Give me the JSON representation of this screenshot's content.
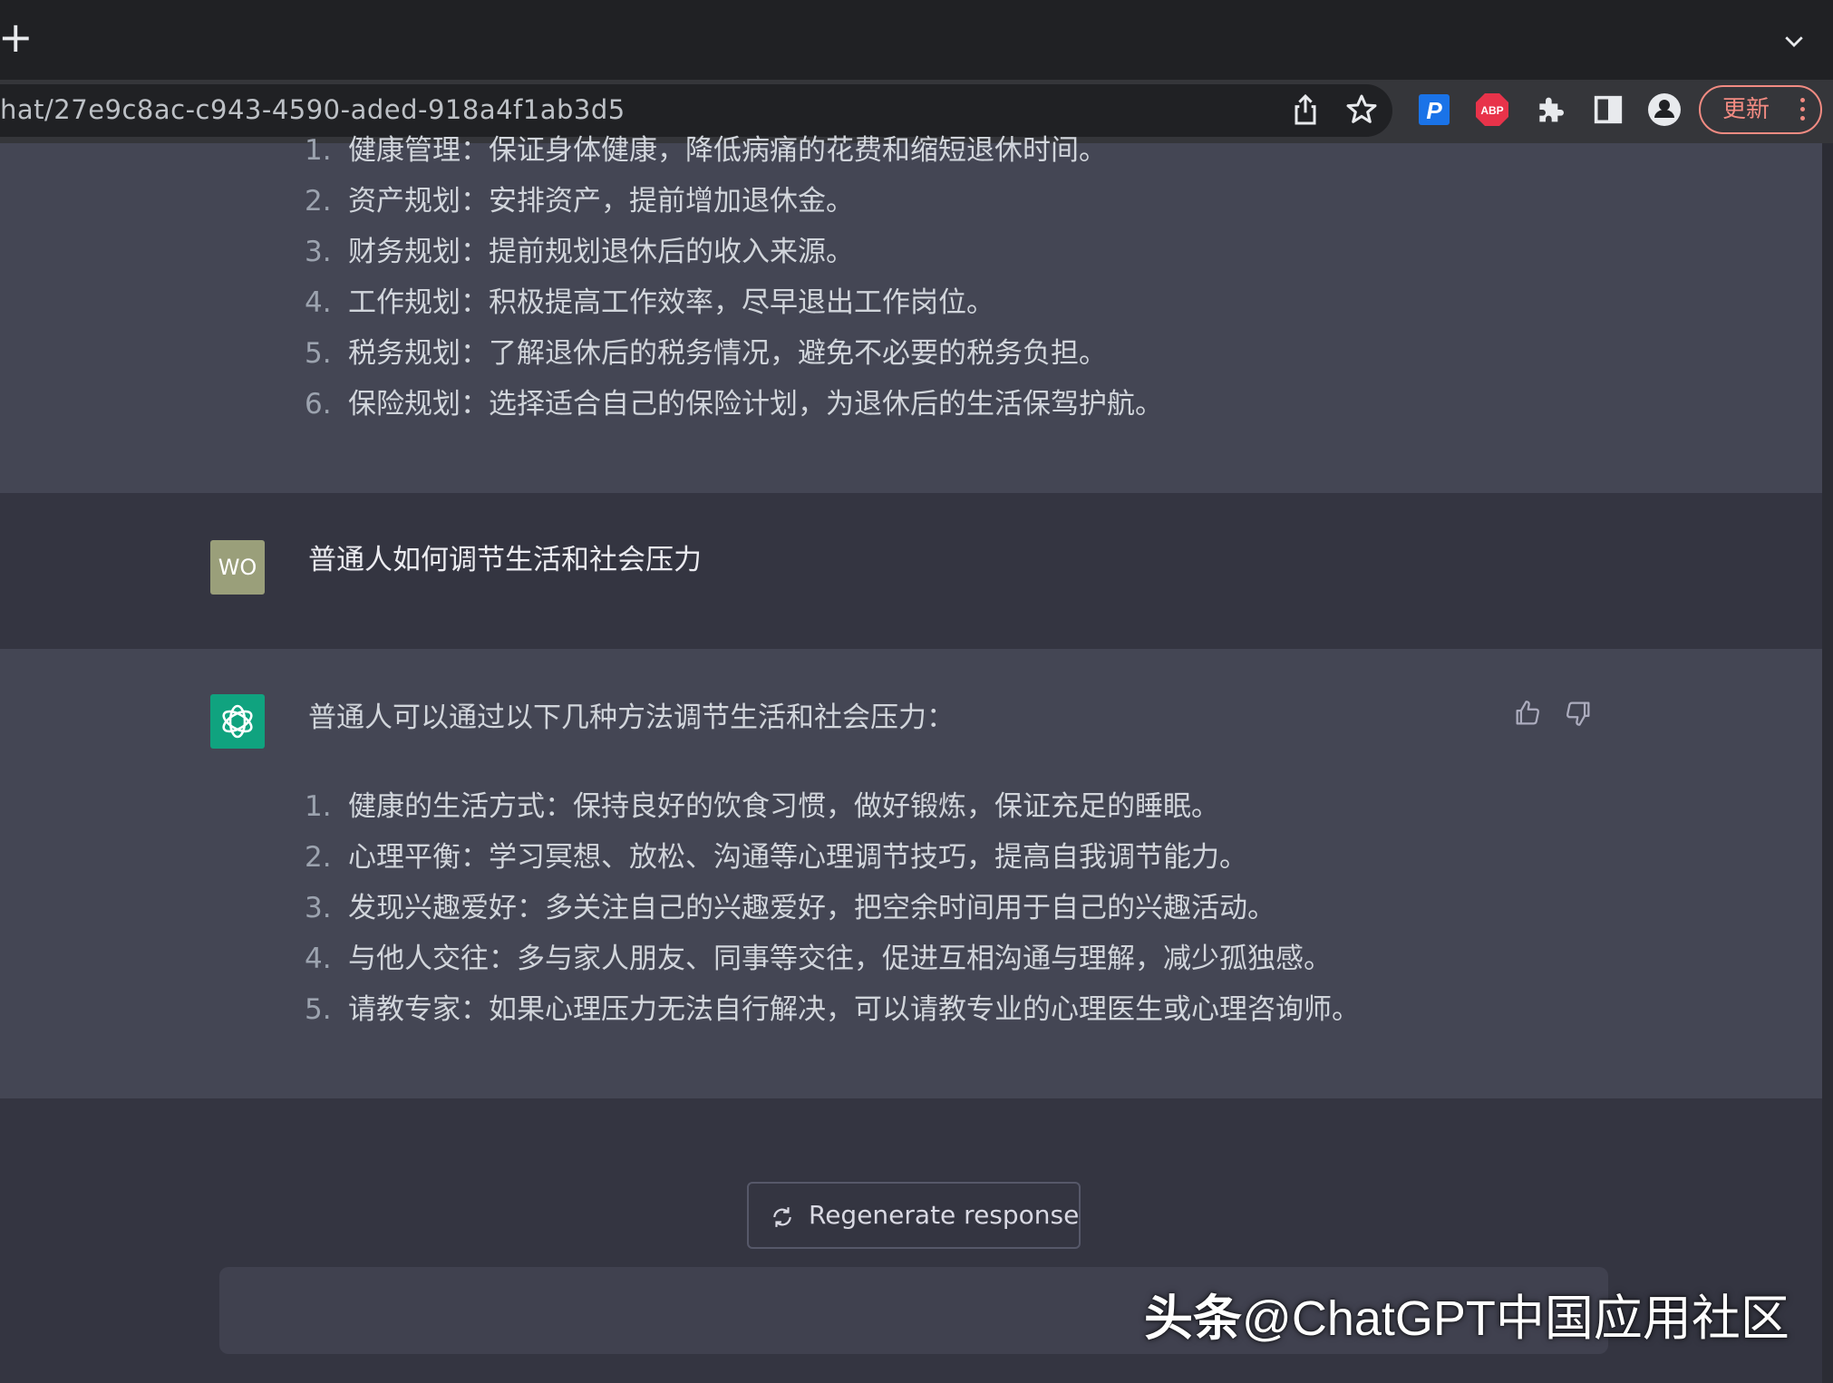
{
  "browser": {
    "url": "hat/27e9c8ac-c943-4590-aded-918a4f1ab3d5",
    "new_tab": "+",
    "update_label": "更新",
    "ext_p": "P",
    "ext_abp": "ABP"
  },
  "chat": {
    "prev_answer_items": [
      {
        "n": "1.",
        "text": "健康管理：保证身体健康，降低病痛的花费和缩短退休时间。"
      },
      {
        "n": "2.",
        "text": "资产规划：安排资产，提前增加退休金。"
      },
      {
        "n": "3.",
        "text": "财务规划：提前规划退休后的收入来源。"
      },
      {
        "n": "4.",
        "text": "工作规划：积极提高工作效率，尽早退出工作岗位。"
      },
      {
        "n": "5.",
        "text": "税务规划：了解退休后的税务情况，避免不必要的税务负担。"
      },
      {
        "n": "6.",
        "text": "保险规划：选择适合自己的保险计划，为退休后的生活保驾护航。"
      }
    ],
    "user_avatar": "WO",
    "user_message": "普通人如何调节生活和社会压力",
    "answer_intro": "普通人可以通过以下几种方法调节生活和社会压力：",
    "answer_items": [
      {
        "n": "1.",
        "text": "健康的生活方式：保持良好的饮食习惯，做好锻炼，保证充足的睡眠。"
      },
      {
        "n": "2.",
        "text": "心理平衡：学习冥想、放松、沟通等心理调节技巧，提高自我调节能力。"
      },
      {
        "n": "3.",
        "text": "发现兴趣爱好：多关注自己的兴趣爱好，把空余时间用于自己的兴趣活动。"
      },
      {
        "n": "4.",
        "text": "与他人交往：多与家人朋友、同事等交往，促进互相沟通与理解，减少孤独感。"
      },
      {
        "n": "5.",
        "text": "请教专家：如果心理压力无法自行解决，可以请教专业的心理医生或心理咨询师。"
      }
    ],
    "regenerate_label": "Regenerate response"
  },
  "watermark": {
    "brand": "头条",
    "handle": "@ChatGPT中国应用社区"
  },
  "colors": {
    "chat_bg": "#343541",
    "assistant_bg": "#444654",
    "gpt_green": "#10a37f",
    "update_red": "#f28b82"
  }
}
